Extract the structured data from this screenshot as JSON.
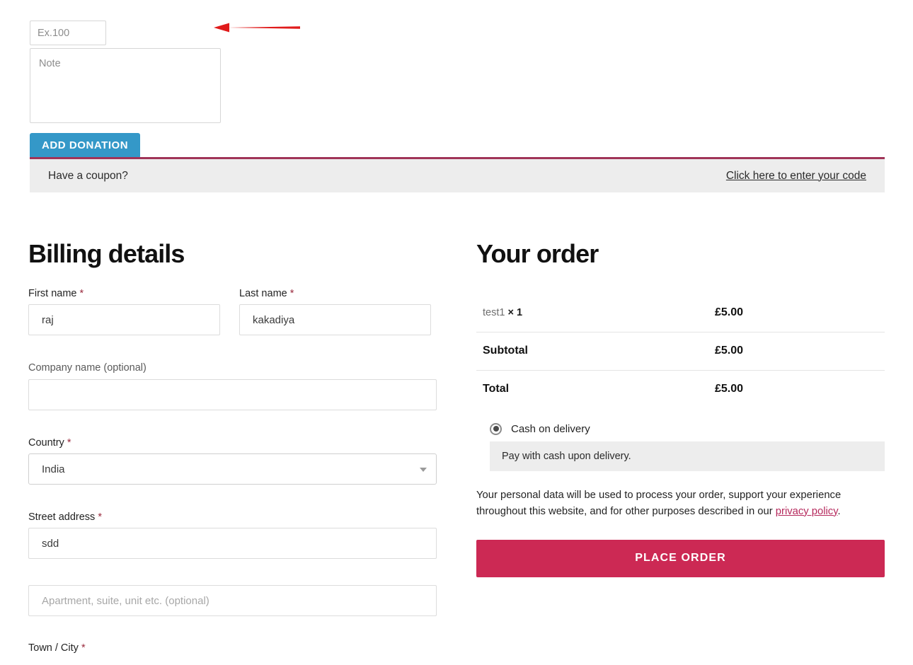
{
  "donation": {
    "amount_placeholder": "Ex.100",
    "amount_value": "",
    "note_placeholder": "Note",
    "note_value": "",
    "add_button_label": "ADD DONATION"
  },
  "annotation": {
    "arrow_color": "#e01b1b",
    "direction": "left"
  },
  "coupon": {
    "prompt": "Have a coupon?",
    "link_label": "Click here to enter your code",
    "accent_color": "#a03458",
    "background": "#ededed"
  },
  "billing": {
    "title": "Billing details",
    "fields": [
      {
        "label": "First name",
        "required": "*",
        "value": "raj",
        "placeholder": ""
      },
      {
        "label": "Last name",
        "required": "*",
        "value": "kakadiya",
        "placeholder": ""
      },
      {
        "label": "Company name (optional)",
        "required": "",
        "value": "",
        "placeholder": ""
      },
      {
        "label": "Country",
        "required": "*",
        "value": "India",
        "placeholder": ""
      },
      {
        "label": "Street address",
        "required": "*",
        "value": "sdd",
        "placeholder": ""
      },
      {
        "label": "",
        "required": "",
        "value": "",
        "placeholder": "Apartment, suite, unit etc. (optional)"
      },
      {
        "label": "Town / City",
        "required": "*",
        "value": "",
        "placeholder": ""
      }
    ]
  },
  "order": {
    "title": "Your order",
    "items": [
      {
        "name": "test1",
        "qty": "× 1",
        "amount": "£5.00"
      }
    ],
    "totals": [
      {
        "label": "Subtotal",
        "amount": "£5.00"
      },
      {
        "label": "Total",
        "amount": "£5.00"
      }
    ],
    "payment": {
      "option_label": "Cash on delivery",
      "option_description": "Pay with cash upon delivery.",
      "selected": "Cash on delivery"
    },
    "privacy_text_before": "Your personal data will be used to process your order, support your experience throughout this website, and for other purposes described in our ",
    "privacy_link_label": "privacy policy",
    "privacy_text_after": ".",
    "place_order_label": "PLACE ORDER",
    "place_order_color": "#cc2954"
  }
}
